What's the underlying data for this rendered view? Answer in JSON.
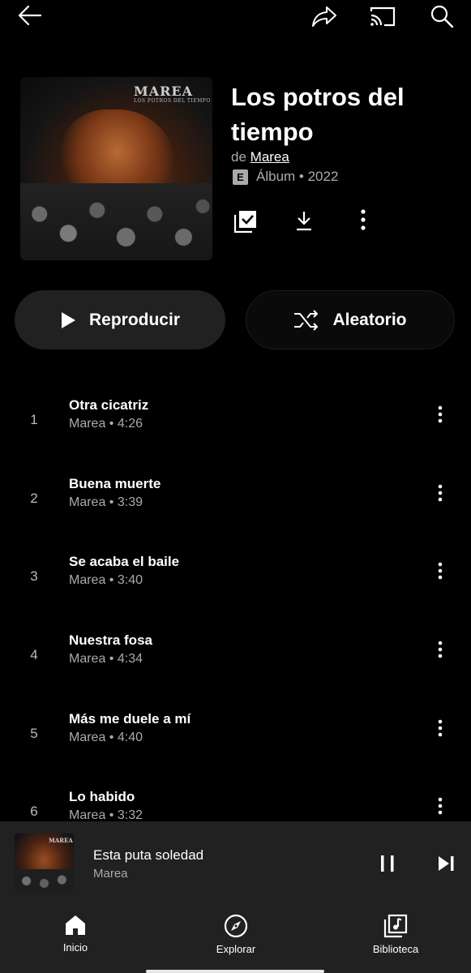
{
  "topbar": {
    "back_icon": "arrow-left-icon",
    "share_icon": "share-icon",
    "cast_icon": "cast-icon",
    "search_icon": "search-icon"
  },
  "album": {
    "cover_band": "MAREA",
    "cover_subtitle": "LOS POTROS DEL TIEMPO",
    "title": "Los potros del tiempo",
    "artist_prefix": "de",
    "artist": "Marea",
    "explicit_badge": "E",
    "meta": "Álbum • 2022",
    "actions": {
      "save_icon": "library-check-icon",
      "download_icon": "download-icon",
      "more_icon": "more-vertical-icon"
    }
  },
  "buttons": {
    "play_label": "Reproducir",
    "shuffle_label": "Aleatorio"
  },
  "tracks": [
    {
      "number": "1",
      "title": "Otra cicatriz",
      "subtitle": "Marea • 4:26"
    },
    {
      "number": "2",
      "title": "Buena muerte",
      "subtitle": "Marea • 3:39"
    },
    {
      "number": "3",
      "title": "Se acaba el baile",
      "subtitle": "Marea • 3:40"
    },
    {
      "number": "4",
      "title": "Nuestra fosa",
      "subtitle": "Marea • 4:34"
    },
    {
      "number": "5",
      "title": "Más me duele a mí",
      "subtitle": "Marea • 4:40"
    },
    {
      "number": "6",
      "title": "Lo habido",
      "subtitle": "Marea • 3:32"
    }
  ],
  "mini_player": {
    "cover_band": "MAREA",
    "title": "Esta puta soledad",
    "artist": "Marea"
  },
  "nav": {
    "home": "Inicio",
    "explore": "Explorar",
    "library": "Biblioteca"
  },
  "colors": {
    "background": "#000000",
    "surface": "#212121",
    "secondary_text": "#aaaaaa"
  }
}
